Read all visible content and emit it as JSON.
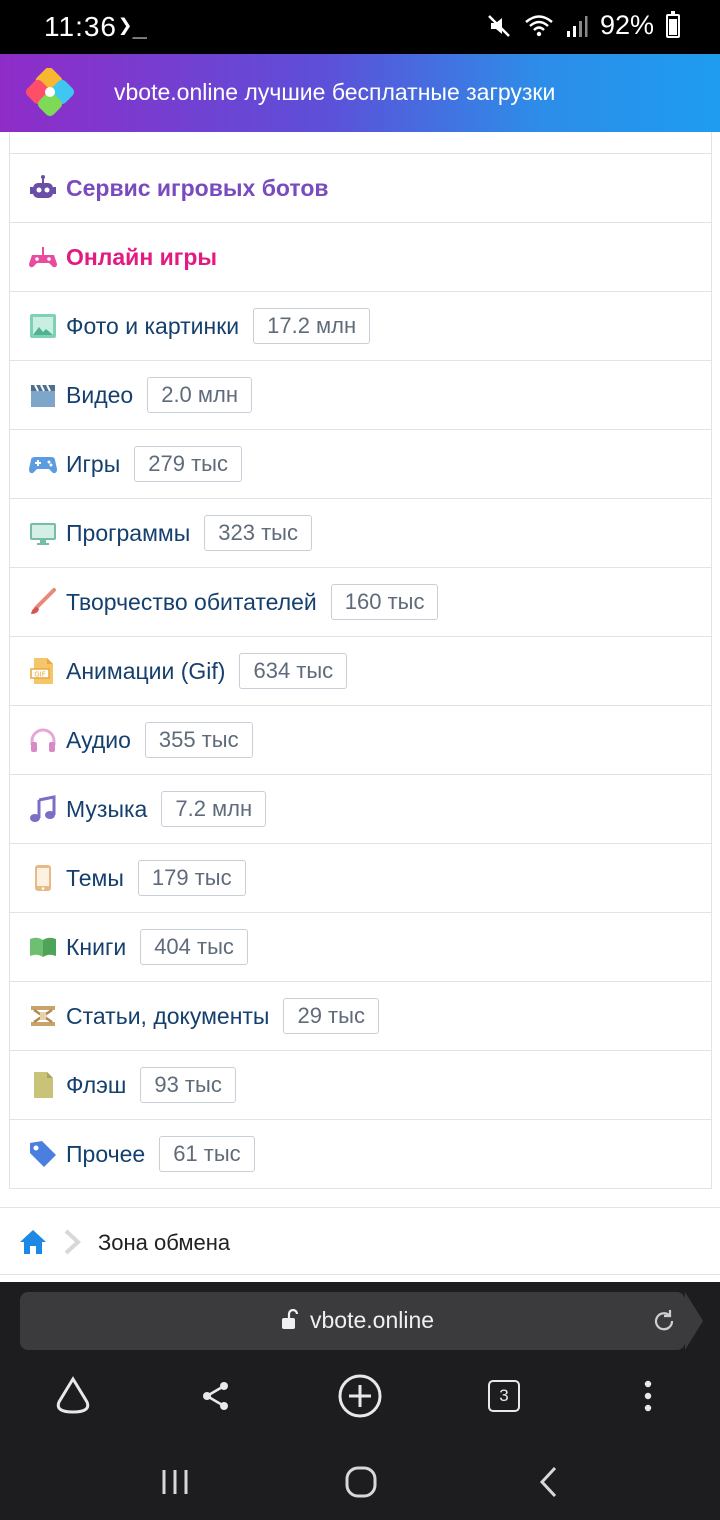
{
  "status_bar": {
    "time": "11:36",
    "terminal_glyph": "❯_",
    "battery_percent": "92%"
  },
  "header": {
    "title": "vbote.online лучшие бесплатные загрузки"
  },
  "menu": {
    "items": [
      {
        "icon": "robot-icon",
        "label": "Сервис игровых ботов",
        "style": "bold-purple"
      },
      {
        "icon": "gamepad-pink-icon",
        "label": "Онлайн игры",
        "style": "bold-pink"
      },
      {
        "icon": "image-icon",
        "label": "Фото и картинки",
        "count": "17.2 млн"
      },
      {
        "icon": "clapperboard-icon",
        "label": "Видео",
        "count": "2.0 млн"
      },
      {
        "icon": "gamepad-icon",
        "label": "Игры",
        "count": "279 тыс"
      },
      {
        "icon": "monitor-icon",
        "label": "Программы",
        "count": "323 тыс"
      },
      {
        "icon": "brush-icon",
        "label": "Творчество обитателей",
        "count": "160 тыс"
      },
      {
        "icon": "gif-file-icon",
        "label": "Анимации (Gif)",
        "count": "634 тыс"
      },
      {
        "icon": "headphones-icon",
        "label": "Аудио",
        "count": "355 тыс"
      },
      {
        "icon": "music-note-icon",
        "label": "Музыка",
        "count": "7.2 млн"
      },
      {
        "icon": "phone-icon",
        "label": "Темы",
        "count": "179 тыс"
      },
      {
        "icon": "book-icon",
        "label": "Книги",
        "count": "404 тыс"
      },
      {
        "icon": "documents-icon",
        "label": "Статьи, документы",
        "count": "29 тыс"
      },
      {
        "icon": "flash-file-icon",
        "label": "Флэш",
        "count": "93 тыс"
      },
      {
        "icon": "tag-icon",
        "label": "Прочее",
        "count": "61 тыс"
      }
    ]
  },
  "breadcrumb": {
    "current": "Зона обмена"
  },
  "browser": {
    "url": "vbote.online",
    "tab_count": "3"
  },
  "colors": {
    "link": "#15406e",
    "purple": "#7a4bbf",
    "pink": "#e21a82",
    "header_start": "#8f2cc8",
    "header_end": "#1e9cf0"
  }
}
